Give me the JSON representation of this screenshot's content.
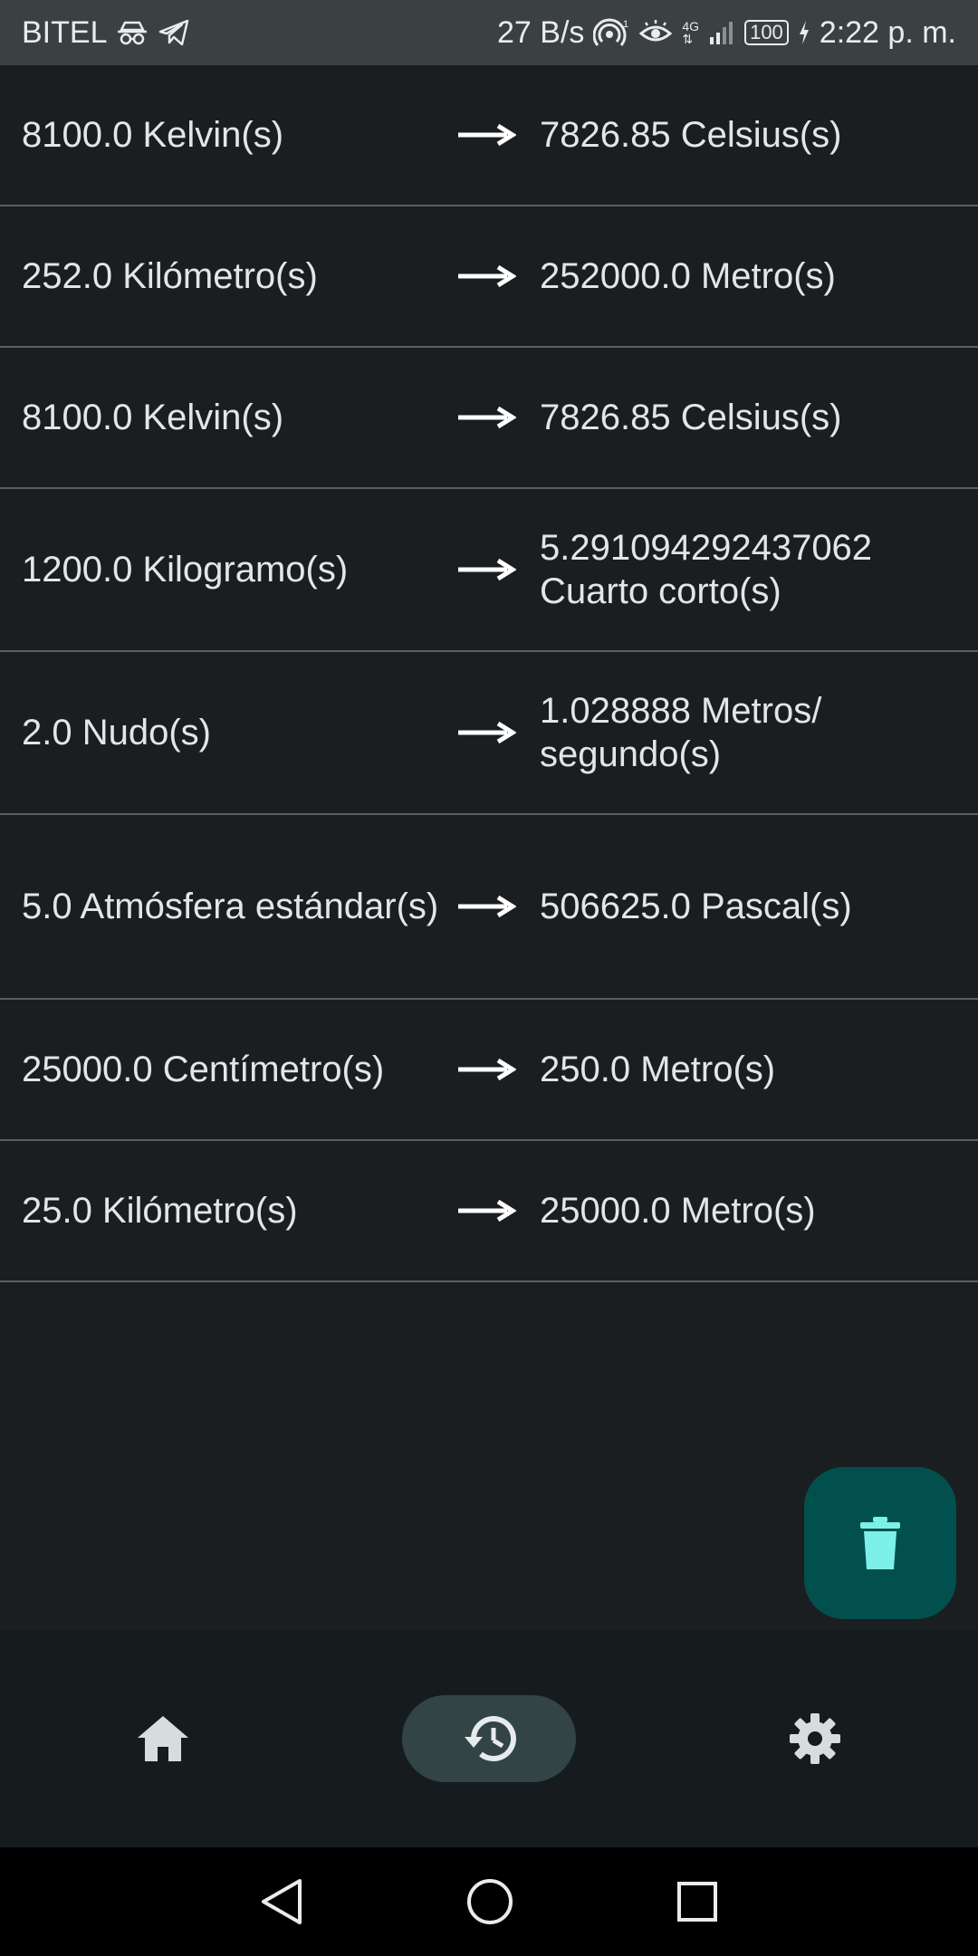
{
  "status_bar": {
    "carrier": "BITEL",
    "net_speed": "27 B/s",
    "network_type": "4G",
    "battery": "100",
    "time": "2:22 p. m."
  },
  "history": [
    {
      "from": "8100.0 Kelvin(s)",
      "to": "7826.85 Celsius(s)"
    },
    {
      "from": "252.0 Kilómetro(s)",
      "to": "252000.0 Metro(s)"
    },
    {
      "from": "8100.0 Kelvin(s)",
      "to": "7826.85 Celsius(s)"
    },
    {
      "from": "1200.0 Kilogramo(s)",
      "to": "5.291094292437062 Cuarto corto(s)"
    },
    {
      "from": "2.0 Nudo(s)",
      "to": "1.028888 Metros/ segundo(s)"
    },
    {
      "from": "5.0 Atmósfera estándar(s)",
      "to": "506625.0 Pascal(s)"
    },
    {
      "from": "25000.0 Centímetro(s)",
      "to": "250.0 Metro(s)"
    },
    {
      "from": "25.0 Kilómetro(s)",
      "to": "25000.0 Metro(s)"
    }
  ],
  "fab": {
    "icon": "trash-icon",
    "color": "#01504d",
    "icon_color": "#7ef0ea"
  },
  "bottom_nav": {
    "items": [
      {
        "icon": "home-icon",
        "active": false
      },
      {
        "icon": "history-icon",
        "active": true
      },
      {
        "icon": "gear-icon",
        "active": false
      }
    ]
  },
  "colors": {
    "background": "#1b1e20",
    "status_bar": "#3b4042",
    "nav_bar": "#161c1e",
    "active_pill": "#334447",
    "divider": "#5a5f62"
  }
}
